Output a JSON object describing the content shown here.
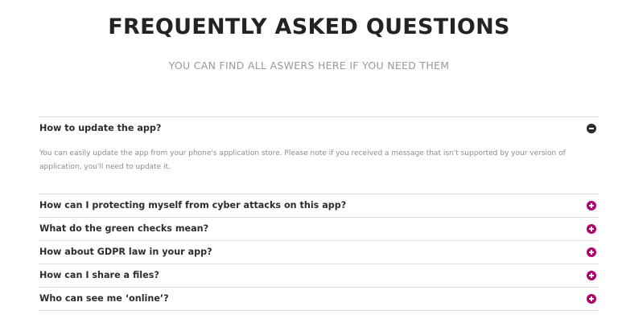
{
  "header": {
    "title": "FREQUENTLY ASKED QUESTIONS",
    "subtitle": "YOU CAN FIND ALL ASWERS HERE IF YOU NEED THEM"
  },
  "faq": {
    "items": [
      {
        "question": "How to update the app?",
        "answer": "You can easily update the app from your phone's application store. Please note if you received a message that isn't supported by your version of application, you'll need to update it.",
        "expanded": true,
        "icon": "minus-circle-icon"
      },
      {
        "question": "How can I protecting myself from cyber attacks on this app?",
        "expanded": false,
        "icon": "plus-circle-icon"
      },
      {
        "question": "What do the green checks mean?",
        "expanded": false,
        "icon": "plus-circle-icon"
      },
      {
        "question": "How about GDPR law in your app?",
        "expanded": false,
        "icon": "plus-circle-icon"
      },
      {
        "question": "How can I share a files?",
        "expanded": false,
        "icon": "plus-circle-icon"
      },
      {
        "question": "Who can see me ‘online’?",
        "expanded": false,
        "icon": "plus-circle-icon"
      }
    ]
  },
  "colors": {
    "accent": "#b3006e",
    "open_icon": "#2b2b2b",
    "title": "#232323",
    "subtitle": "#9a9a9a",
    "answer_text": "#8c8c8c",
    "divider": "#dedede"
  }
}
